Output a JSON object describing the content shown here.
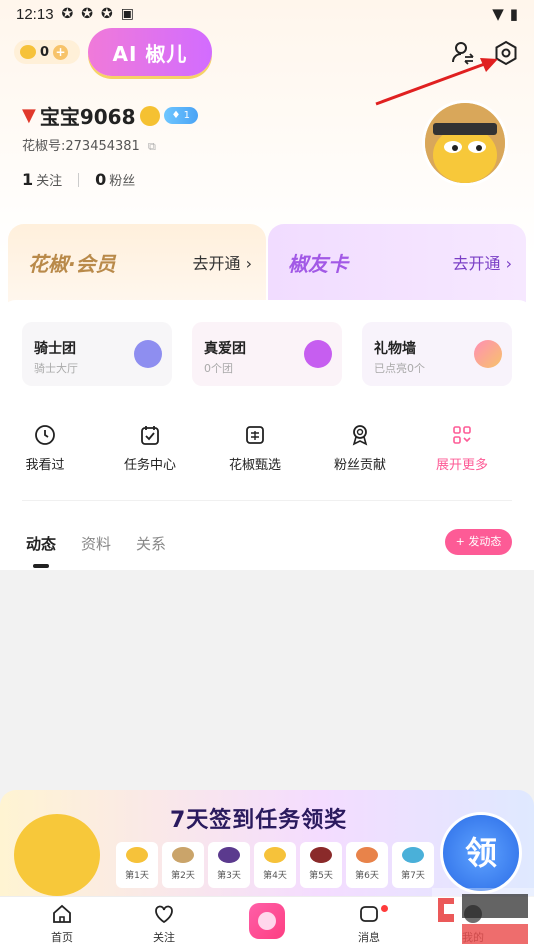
{
  "status_bar": {
    "time": "12:13"
  },
  "header": {
    "coins": "0",
    "ai_button": "AI 椒儿"
  },
  "profile": {
    "nickname": "宝宝9068",
    "vip_level": "1",
    "uid": "花椒号:273454381",
    "following_count": "1",
    "following_label": "关注",
    "fans_count": "0",
    "fans_label": "粉丝"
  },
  "cards": [
    {
      "title": "花椒·会员",
      "link": "去开通 ›"
    },
    {
      "title": "椒友卡",
      "link": "去开通 ›"
    }
  ],
  "groups": [
    {
      "title": "骑士团",
      "sub": "骑士大厅"
    },
    {
      "title": "真爱团",
      "sub": "0个团"
    },
    {
      "title": "礼物墙",
      "sub": "已点亮0个"
    }
  ],
  "quick_actions": [
    {
      "label": "我看过",
      "icon": "clock-icon"
    },
    {
      "label": "任务中心",
      "icon": "task-icon"
    },
    {
      "label": "花椒甄选",
      "icon": "selection-icon"
    },
    {
      "label": "粉丝贡献",
      "icon": "medal-icon"
    },
    {
      "label": "展开更多",
      "icon": "grid-icon"
    }
  ],
  "tabs": [
    "动态",
    "资料",
    "关系"
  ],
  "post_button": "+ 发动态",
  "banner": {
    "title": "7天签到任务领奖",
    "days": [
      "第1天",
      "第2天",
      "第3天",
      "第4天",
      "第5天",
      "第6天",
      "第7天"
    ],
    "claim": "领"
  },
  "nav": [
    "首页",
    "关注",
    "消息",
    "我的"
  ],
  "colors": {
    "accent_pink": "#fd5b96",
    "ai_purple": "#d26cff"
  }
}
